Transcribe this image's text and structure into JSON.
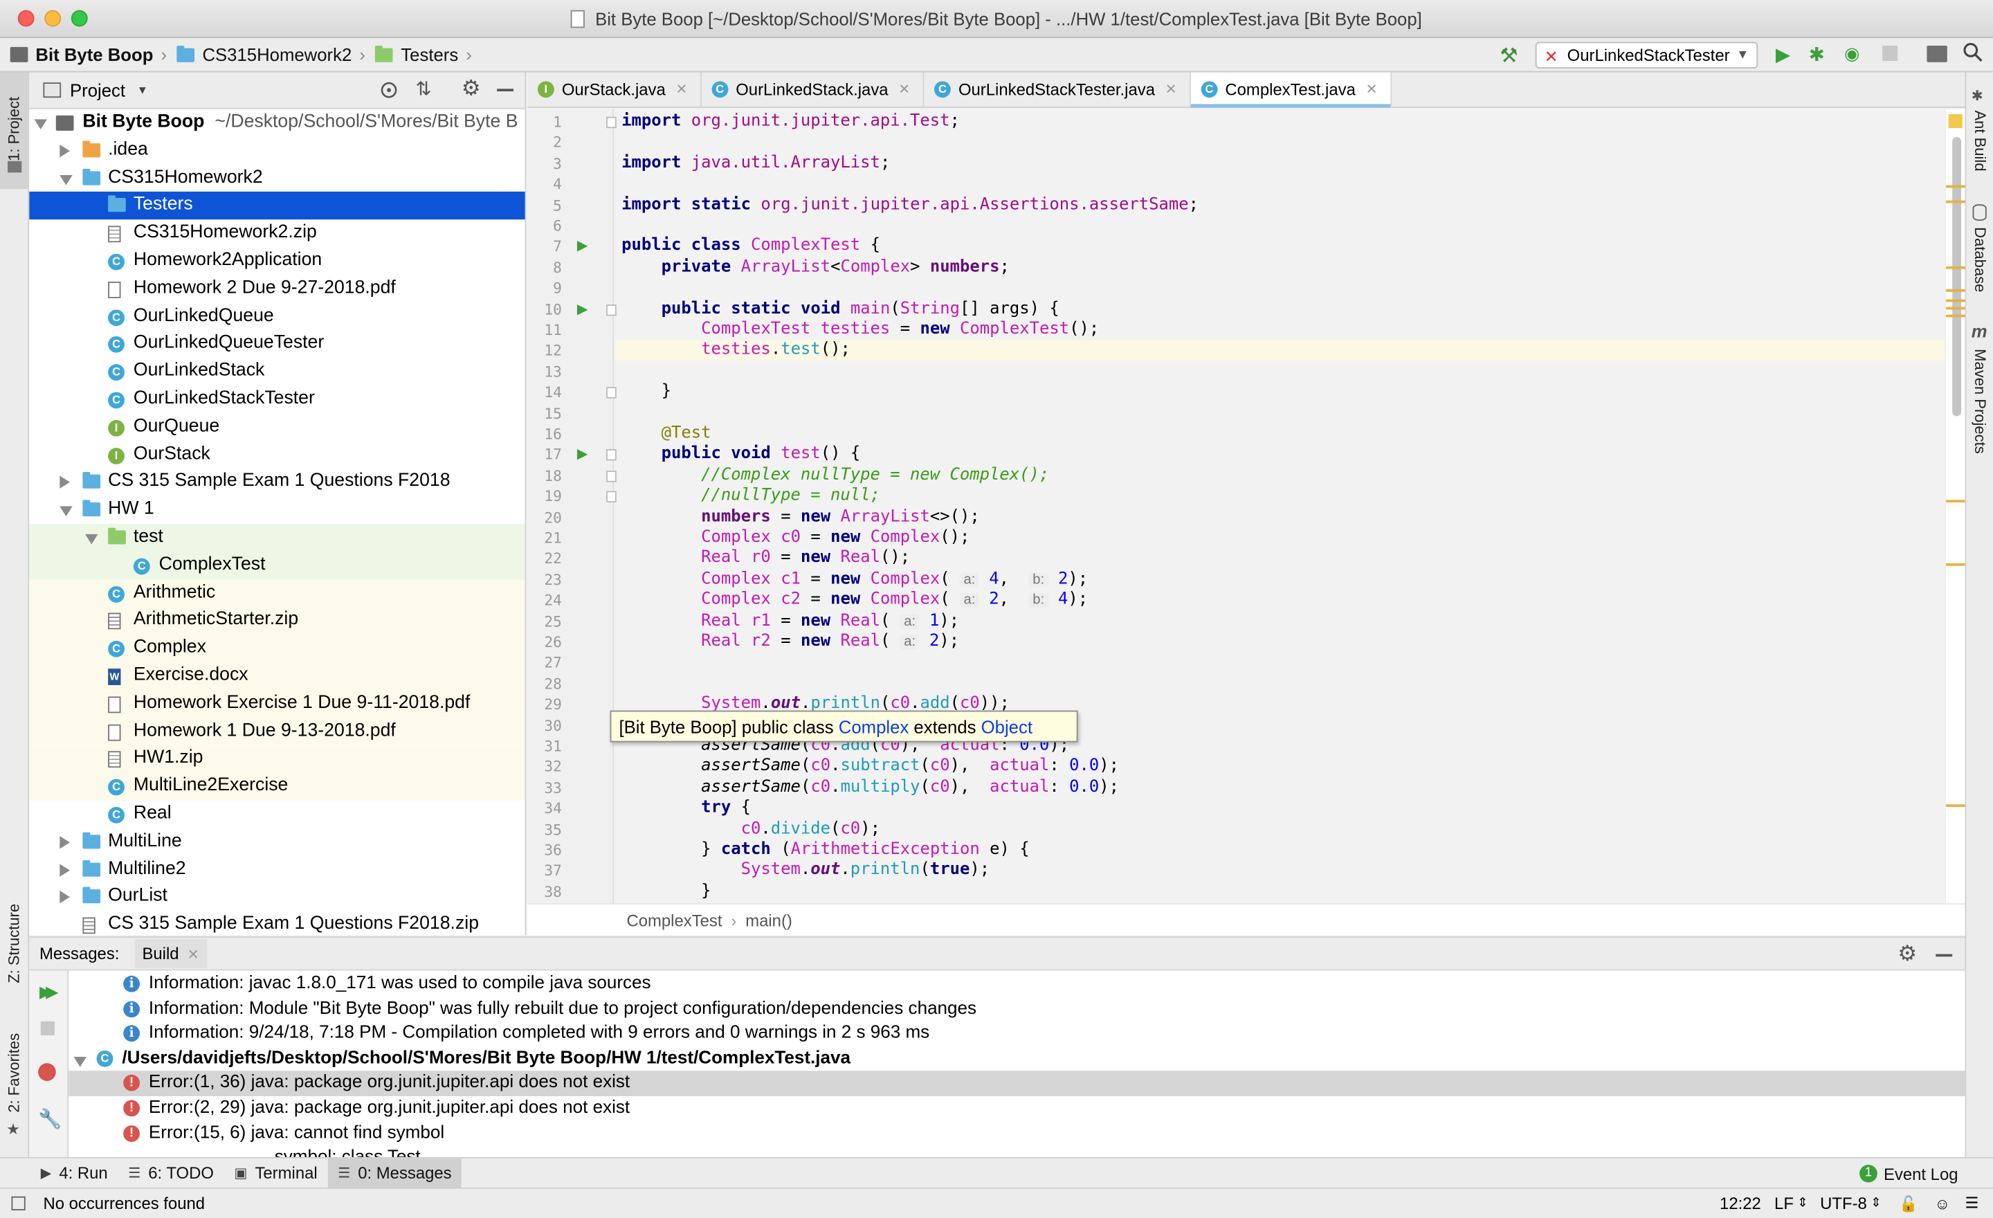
{
  "window": {
    "title": "Bit Byte Boop [~/Desktop/School/S'Mores/Bit Byte Boop] - .../HW 1/test/ComplexTest.java [Bit Byte Boop]"
  },
  "navbar": {
    "crumbs": [
      "Bit Byte Boop",
      "CS315Homework2",
      "Testers"
    ],
    "run_config": "OurLinkedStackTester"
  },
  "left_stripe": {
    "project": "1: Project",
    "structure": "Z: Structure",
    "favorites": "2: Favorites"
  },
  "right_stripe": {
    "ant": "Ant Build",
    "database": "Database",
    "maven": "Maven Projects"
  },
  "project_panel": {
    "title": "Project",
    "root_name": "Bit Byte Boop",
    "root_path": "~/Desktop/School/S'Mores/Bit Byte B",
    "items": [
      {
        "label": ".idea",
        "depth": 1,
        "icon": "folder-orange",
        "arrow": "right"
      },
      {
        "label": "CS315Homework2",
        "depth": 1,
        "icon": "folder-blue",
        "arrow": "down"
      },
      {
        "label": "Testers",
        "depth": 2,
        "icon": "folder-blue",
        "arrow": "none",
        "selected": true
      },
      {
        "label": "CS315Homework2.zip",
        "depth": 2,
        "icon": "zip",
        "arrow": "none"
      },
      {
        "label": "Homework2Application",
        "depth": 2,
        "icon": "class-run",
        "arrow": "none"
      },
      {
        "label": "Homework 2 Due 9-27-2018.pdf",
        "depth": 2,
        "icon": "file",
        "arrow": "none"
      },
      {
        "label": "OurLinkedQueue",
        "depth": 2,
        "icon": "class",
        "arrow": "none"
      },
      {
        "label": "OurLinkedQueueTester",
        "depth": 2,
        "icon": "class-run",
        "arrow": "none"
      },
      {
        "label": "OurLinkedStack",
        "depth": 2,
        "icon": "class",
        "arrow": "none"
      },
      {
        "label": "OurLinkedStackTester",
        "depth": 2,
        "icon": "class-run",
        "arrow": "none"
      },
      {
        "label": "OurQueue",
        "depth": 2,
        "icon": "interface",
        "arrow": "none"
      },
      {
        "label": "OurStack",
        "depth": 2,
        "icon": "interface",
        "arrow": "none"
      },
      {
        "label": "CS 315 Sample Exam 1 Questions F2018",
        "depth": 1,
        "icon": "folder-blue",
        "arrow": "right"
      },
      {
        "label": "HW 1",
        "depth": 1,
        "icon": "folder-blue",
        "arrow": "down"
      },
      {
        "label": "test",
        "depth": 2,
        "icon": "folder-green",
        "arrow": "down",
        "highlight": true
      },
      {
        "label": "ComplexTest",
        "depth": 3,
        "icon": "class-run",
        "arrow": "none",
        "highlight": true
      },
      {
        "label": "Arithmetic",
        "depth": 2,
        "icon": "class-run",
        "arrow": "none"
      },
      {
        "label": "ArithmeticStarter.zip",
        "depth": 2,
        "icon": "zip",
        "arrow": "none"
      },
      {
        "label": "Complex",
        "depth": 2,
        "icon": "class",
        "arrow": "none"
      },
      {
        "label": "Exercise.docx",
        "depth": 2,
        "icon": "doc",
        "arrow": "none"
      },
      {
        "label": "Homework Exercise 1 Due 9-11-2018.pdf",
        "depth": 2,
        "icon": "file",
        "arrow": "none"
      },
      {
        "label": "Homework 1 Due 9-13-2018.pdf",
        "depth": 2,
        "icon": "file",
        "arrow": "none"
      },
      {
        "label": "HW1.zip",
        "depth": 2,
        "icon": "zip",
        "arrow": "none"
      },
      {
        "label": "MultiLine2Exercise",
        "depth": 2,
        "icon": "class",
        "arrow": "none"
      },
      {
        "label": "Real",
        "depth": 2,
        "icon": "class",
        "arrow": "none"
      },
      {
        "label": "MultiLine",
        "depth": 1,
        "icon": "folder-blue",
        "arrow": "right"
      },
      {
        "label": "Multiline2",
        "depth": 1,
        "icon": "folder-blue",
        "arrow": "right"
      },
      {
        "label": "OurList",
        "depth": 1,
        "icon": "folder-blue",
        "arrow": "right"
      },
      {
        "label": "CS 315 Sample Exam 1 Questions F2018.zip",
        "depth": 1,
        "icon": "zip",
        "arrow": "none"
      }
    ]
  },
  "editor": {
    "tabs": [
      {
        "label": "OurStack.java",
        "icon": "interface",
        "active": false
      },
      {
        "label": "OurLinkedStack.java",
        "icon": "class",
        "active": false
      },
      {
        "label": "OurLinkedStackTester.java",
        "icon": "class-run",
        "active": false
      },
      {
        "label": "ComplexTest.java",
        "icon": "class-run",
        "active": true
      }
    ],
    "line_numbers": [
      "1",
      "2",
      "3",
      "4",
      "5",
      "6",
      "7",
      "8",
      "9",
      "10",
      "11",
      "12",
      "13",
      "14",
      "15",
      "16",
      "17",
      "18",
      "19",
      "20",
      "21",
      "22",
      "23",
      "24",
      "25",
      "26",
      "27",
      "28",
      "29",
      "30",
      "31",
      "32",
      "33",
      "34",
      "35",
      "36",
      "37",
      "38"
    ],
    "code_lines": [
      "import org.junit.jupiter.api.Test;",
      "",
      "import java.util.ArrayList;",
      "",
      "import static org.junit.jupiter.api.Assertions.assertSame;",
      "",
      "public class ComplexTest {",
      "    private ArrayList<Complex> numbers;",
      "",
      "    public static void main(String[] args) {",
      "        ComplexTest testies = new ComplexTest();",
      "        testies.test();",
      "",
      "    }",
      "",
      "    @Test",
      "    public void test() {",
      "        //Complex nullType = new Complex();",
      "        //nullType = null;",
      "        numbers = new ArrayList<>();",
      "        Complex c0 = new Complex();",
      "        Real r0 = new Real();",
      "        Complex c1 = new Complex( a: 4,  b: 2);",
      "        Complex c2 = new Complex( a: 2,  b: 4);",
      "        Real r1 = new Real( a: 1);",
      "        Real r2 = new Real( a: 2);",
      "",
      "",
      "        System.out.println(c0.add(c0));",
      "",
      "        assertSame(c0.add(c0),  actual: 0.0);",
      "        assertSame(c0.subtract(c0),  actual: 0.0);",
      "        assertSame(c0.multiply(c0),  actual: 0.0);",
      "        try {",
      "            c0.divide(c0);",
      "        } catch (ArithmeticException e) {",
      "            System.out.println(true);",
      "        }"
    ],
    "tooltip": {
      "prefix": "[Bit Byte Boop] public class ",
      "class_link": "Complex",
      "middle": " extends ",
      "super_link": "Object"
    },
    "breadcrumb": [
      "ComplexTest",
      "main()"
    ]
  },
  "messages": {
    "label": "Messages:",
    "tab": "Build",
    "lines": [
      {
        "type": "info",
        "text": "Information: javac 1.8.0_171 was used to compile java sources"
      },
      {
        "type": "info",
        "text": "Information: Module \"Bit Byte Boop\" was fully rebuilt due to project configuration/dependencies changes"
      },
      {
        "type": "info",
        "text": "Information: 9/24/18, 7:18 PM - Compilation completed with 9 errors and 0 warnings in 2 s 963 ms"
      },
      {
        "type": "file",
        "text": "/Users/davidjefts/Desktop/School/S'Mores/Bit Byte Boop/HW 1/test/ComplexTest.java"
      },
      {
        "type": "error",
        "text": "Error:(1, 36)  java: package org.junit.jupiter.api does not exist",
        "selected": true
      },
      {
        "type": "error",
        "text": "Error:(2, 29)  java: package org.junit.jupiter.api does not exist"
      },
      {
        "type": "error",
        "text": "Error:(15, 6)  java: cannot find symbol"
      },
      {
        "type": "sub",
        "text": "symbol:   class Test"
      }
    ]
  },
  "bottom_tools": [
    {
      "label": "4: Run",
      "icon": "play-icon"
    },
    {
      "label": "6: TODO",
      "icon": "list-icon"
    },
    {
      "label": "Terminal",
      "icon": "terminal-icon"
    },
    {
      "label": "0: Messages",
      "icon": "messages-icon",
      "active": true
    }
  ],
  "event_log": {
    "label": "Event Log",
    "count": "1"
  },
  "status": {
    "message": "No occurrences found",
    "position": "12:22",
    "line_sep": "LF",
    "encoding": "UTF-8"
  }
}
